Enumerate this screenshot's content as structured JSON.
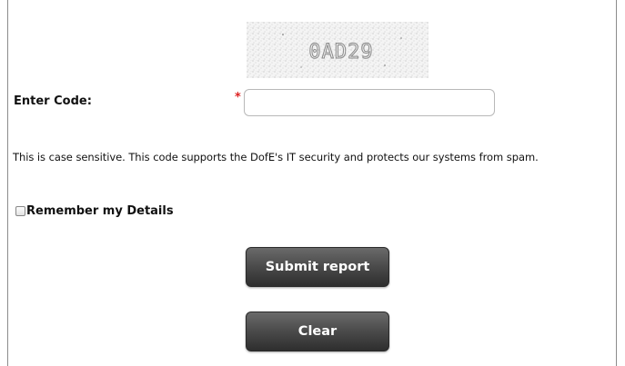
{
  "captcha": {
    "code": "0AD29"
  },
  "form": {
    "code_label": "Enter Code:",
    "required_mark": "*",
    "code_value": "",
    "help_text": "This is case sensitive. This code supports the DofE's IT security and protects our systems from spam.",
    "remember_label": "Remember my Details",
    "remember_checked": false
  },
  "buttons": {
    "submit_label": "Submit report",
    "clear_label": "Clear"
  },
  "colors": {
    "required": "#dd2222",
    "button_top": "#6a6a6a",
    "button_bottom": "#2e2e2e",
    "button_text": "#ffffff"
  }
}
